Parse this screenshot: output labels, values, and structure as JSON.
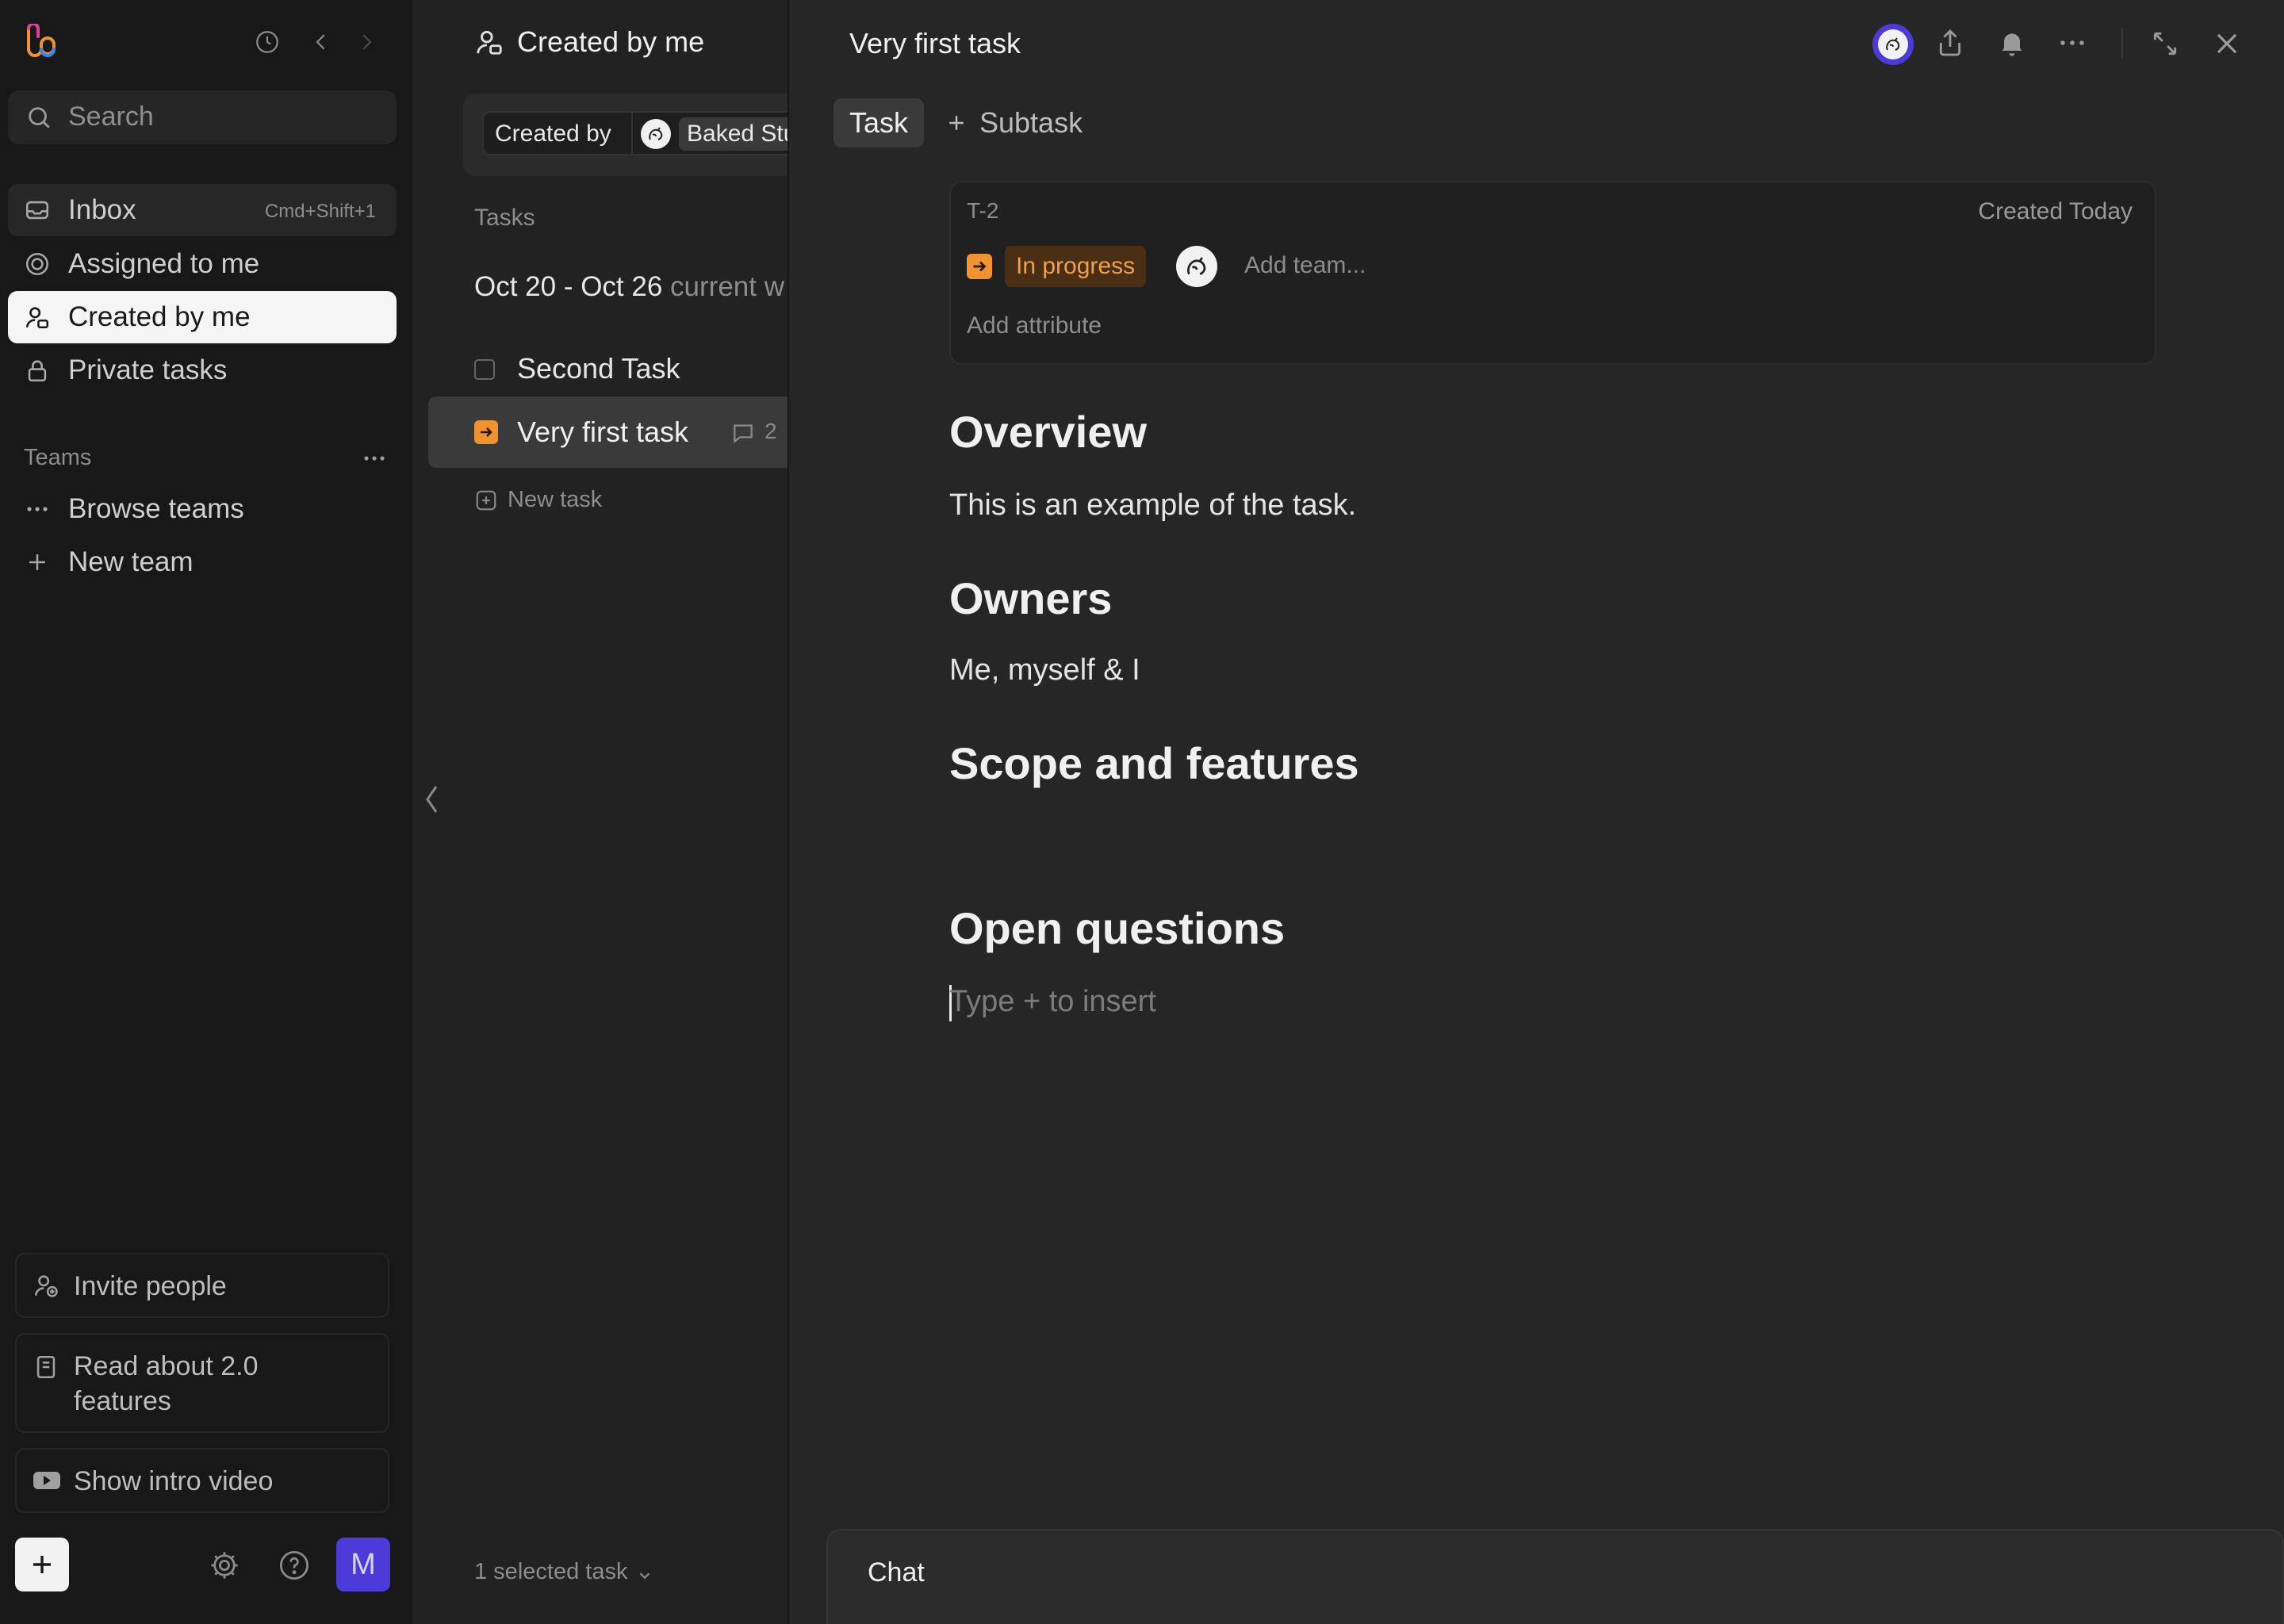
{
  "app": {
    "colors": {
      "accent": "#4d3bd9",
      "status_orange": "#f0922f",
      "active_bg": "#f5f5f5"
    }
  },
  "sidebar": {
    "logo_icon": "app-logo",
    "search": {
      "placeholder": "Search"
    },
    "nav": [
      {
        "label": "Inbox",
        "shortcut": "Cmd+Shift+1",
        "icon": "inbox-icon"
      },
      {
        "label": "Assigned to me",
        "icon": "target-icon"
      },
      {
        "label": "Created by me",
        "icon": "user-icon"
      },
      {
        "label": "Private tasks",
        "icon": "lock-icon"
      }
    ],
    "teams": {
      "title": "Teams",
      "browse_label": "Browse teams",
      "new_label": "New team"
    },
    "bottom": {
      "invite_label": "Invite people",
      "read_label_line1": "Read about 2.0",
      "read_label_line2": "features",
      "video_label": "Show intro video",
      "avatar_letter": "M"
    }
  },
  "list": {
    "title": "Created by me",
    "filter_label": "Created by",
    "filter_value": "Baked Stu",
    "section_label": "Tasks",
    "week_label": "Oct 20 - Oct 26",
    "week_suffix": "current w",
    "tasks": [
      {
        "title": "Second Task",
        "status": "todo"
      },
      {
        "title": "Very first task",
        "status": "in-progress",
        "comments": "2"
      }
    ],
    "new_task_label": "New task",
    "selection_label": "1 selected task"
  },
  "detail": {
    "title": "Very first task",
    "tabs": {
      "task": "Task",
      "subtask": "Subtask"
    },
    "id": "T-2",
    "created": "Created Today",
    "status_label": "In progress",
    "add_team_placeholder": "Add team...",
    "add_attribute_label": "Add attribute",
    "sections": {
      "overview_heading": "Overview",
      "overview_text": "This is an example of the task.",
      "owners_heading": "Owners",
      "owners_text": "Me, myself & I",
      "scope_heading": "Scope and features",
      "questions_heading": "Open questions",
      "editor_placeholder": "Type + to insert"
    },
    "chat_label": "Chat"
  }
}
